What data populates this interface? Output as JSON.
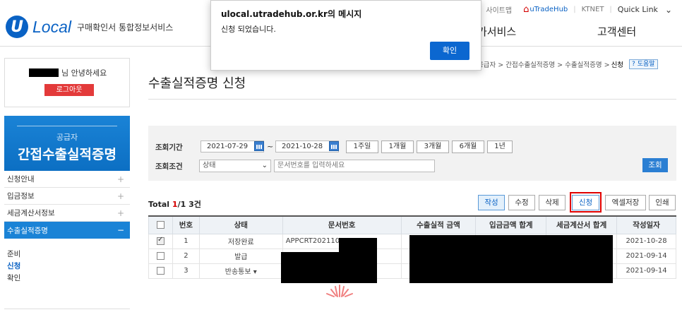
{
  "header": {
    "logo_mark": "U",
    "logo_text": "Local",
    "logo_sub": "구매확인서 통합정보서비스",
    "util": {
      "sitemap": "사이트맵",
      "utradehub": "uTradeHub",
      "ktnet": "KTNET",
      "quick_link": "Quick Link"
    },
    "gnb": [
      "가서비스",
      "고객센터"
    ]
  },
  "sidebar": {
    "greeting": "님 안녕하세요",
    "logout": "로그아웃",
    "menu_sub": "공급자",
    "menu_main": "간접수출실적증명",
    "items": [
      {
        "label": "신청안내"
      },
      {
        "label": "입금정보"
      },
      {
        "label": "세금계산서정보"
      },
      {
        "label": "수출실적증명"
      }
    ],
    "submenu": [
      "준비",
      "신청",
      "확인"
    ]
  },
  "breadcrumb": {
    "path": "공급자 > 간접수출실적증명 > 수출실적증명 >",
    "current": "신청",
    "help": "도움말"
  },
  "page_title": "수출실적증명 신청",
  "search": {
    "period_label": "조회기간",
    "date_from": "2021-07-29",
    "date_to": "2021-10-28",
    "periods": [
      "1주일",
      "1개월",
      "3개월",
      "6개월",
      "1년"
    ],
    "condition_label": "조회조건",
    "status_select": "상태",
    "doc_placeholder": "문서번호를 입력하세요",
    "search_button": "조회"
  },
  "list": {
    "total_label": "Total",
    "page": "1",
    "page_total": "/1",
    "count": "3건",
    "actions": [
      "작성",
      "수정",
      "삭제",
      "신청",
      "엑셀저장",
      "인쇄"
    ],
    "columns": [
      "번호",
      "상태",
      "문서번호",
      "수출실적 금액",
      "입금금액 합계",
      "세금계산서 합계",
      "작성일자"
    ],
    "rows": [
      {
        "no": "1",
        "status": "저장완료",
        "doc": "APPCRT202110",
        "date": "2021-10-28",
        "checked": true
      },
      {
        "no": "2",
        "status": "발급",
        "doc": "",
        "date": "2021-09-14",
        "checked": false
      },
      {
        "no": "3",
        "status": "반송통보",
        "doc": "",
        "date": "2021-09-14",
        "checked": false
      }
    ]
  },
  "dialog": {
    "title": "ulocal.utradehub.or.kr의 메시지",
    "message": "신청 되었습니다.",
    "ok": "확인"
  },
  "colors": {
    "brand": "#0a62c4",
    "logout": "#e33a3a",
    "highlight": "#e00000"
  }
}
